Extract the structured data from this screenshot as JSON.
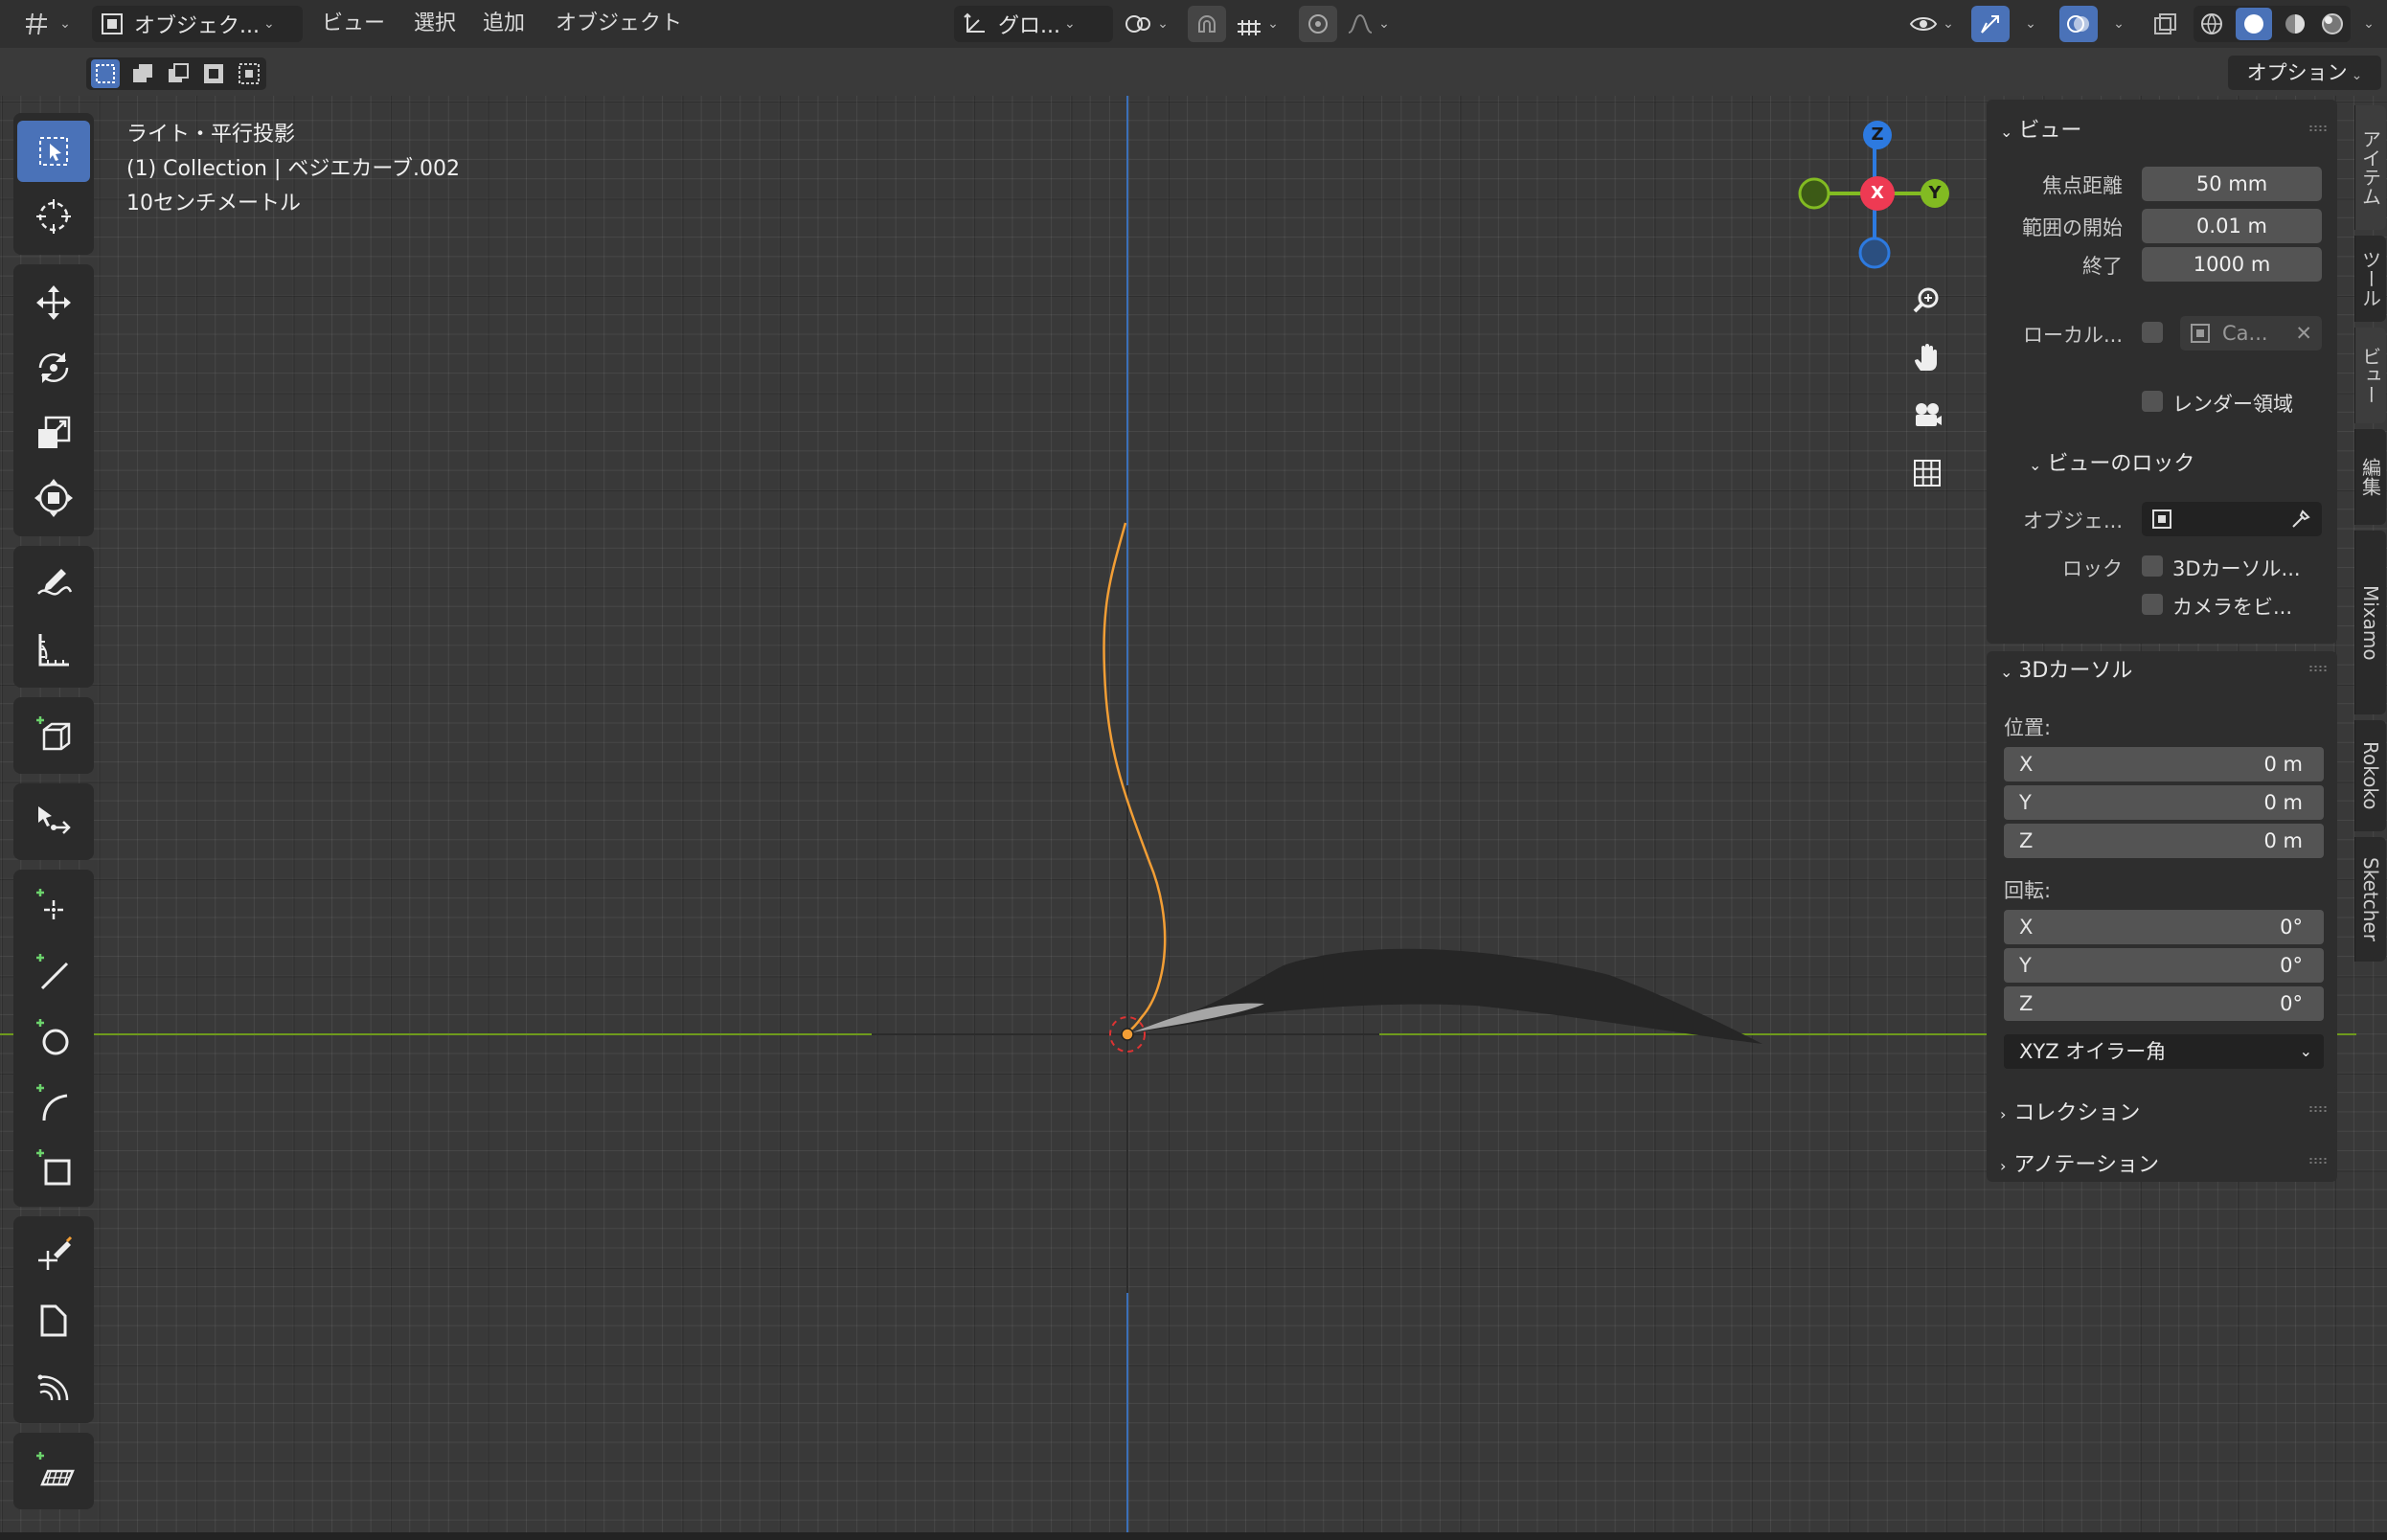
{
  "header": {
    "mode_label": "オブジェク...",
    "menu_view": "ビュー",
    "menu_select": "選択",
    "menu_add": "追加",
    "menu_object": "オブジェクト",
    "transform_orientation": "グロ...",
    "options_label": "オプション"
  },
  "viewport_info": {
    "line1": "ライト・平行投影",
    "line2": "(1) Collection | ベジエカーブ.002",
    "line3": "10センチメートル"
  },
  "gizmo": {
    "x": "X",
    "y": "Y",
    "z": "Z"
  },
  "toolbar": {
    "icons": [
      "select-box-icon",
      "cursor-icon",
      "move-icon",
      "rotate-icon",
      "scale-icon",
      "transform-icon",
      "annotate-icon",
      "measure-icon",
      "add-cube-icon",
      "extrude-cursor-icon",
      "draw-point-icon",
      "draw-line-icon",
      "draw-circle-icon",
      "draw-arc-icon",
      "draw-rect-icon",
      "knife-icon",
      "shear-icon",
      "spin-icon",
      "add-plane-icon"
    ]
  },
  "npanel": {
    "view": {
      "title": "ビュー",
      "focal_label": "焦点距離",
      "focal_value": "50 mm",
      "clip_start_label": "範囲の開始",
      "clip_start_value": "0.01 m",
      "clip_end_label": "終了",
      "clip_end_value": "1000 m",
      "local_label": "ローカル...",
      "local_camera": "Ca...",
      "render_region": "レンダー領域"
    },
    "view_lock": {
      "title": "ビューのロック",
      "object_label": "オブジェ...",
      "lock_label": "ロック",
      "lock_cursor": "3Dカーソル...",
      "lock_camera": "カメラをビ..."
    },
    "cursor": {
      "title": "3Dカーソル",
      "location_label": "位置:",
      "loc": [
        {
          "k": "X",
          "v": "0 m"
        },
        {
          "k": "Y",
          "v": "0 m"
        },
        {
          "k": "Z",
          "v": "0 m"
        }
      ],
      "rotation_label": "回転:",
      "rot": [
        {
          "k": "X",
          "v": "0°"
        },
        {
          "k": "Y",
          "v": "0°"
        },
        {
          "k": "Z",
          "v": "0°"
        }
      ],
      "rotation_mode": "XYZ オイラー角"
    },
    "collection_title": "コレクション",
    "annotation_title": "アノテーション"
  },
  "sidetabs": [
    "アイテム",
    "ツール",
    "ビュー",
    "編集",
    "Mixamo",
    "Rokoko",
    "Sketcher"
  ],
  "colors": {
    "accent_blue": "#4a72b8",
    "axis_x": "#ee3a53",
    "axis_y": "#82bb22",
    "axis_z": "#2d7ae0",
    "curve_orange": "#f29e35"
  }
}
